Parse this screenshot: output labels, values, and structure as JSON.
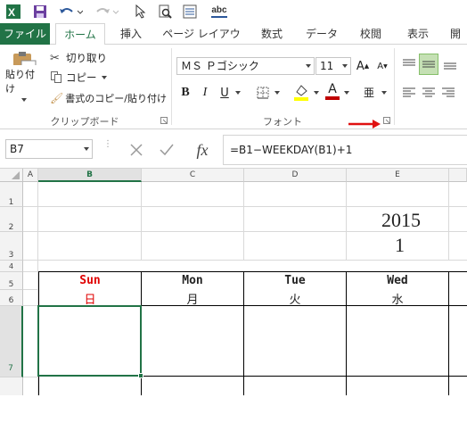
{
  "qat": {
    "app_icon": "excel-logo-icon",
    "save_icon": "save-icon",
    "undo_icon": "undo-icon",
    "redo_icon": "redo-icon",
    "pointer_icon": "pointer-icon",
    "preview_icon": "print-preview-icon",
    "form_icon": "form-icon",
    "spell_label": "abc"
  },
  "tabs": [
    "ファイル",
    "ホーム",
    "挿入",
    "ページ レイアウト",
    "数式",
    "データ",
    "校閲",
    "表示",
    "開"
  ],
  "clipboard": {
    "paste_label": "貼り付け",
    "cut_label": "切り取り",
    "copy_label": "コピー",
    "format_painter_label": "書式のコピー/貼り付け",
    "group_label": "クリップボード"
  },
  "font": {
    "font_name": "ＭＳ Ｐゴシック",
    "font_size": "11",
    "grow_label": "A",
    "shrink_label": "A",
    "bold_label": "B",
    "italic_label": "I",
    "underline_label": "U",
    "font_color_label": "A",
    "phonetic_label": "亜",
    "group_label": "フォント"
  },
  "colors": {
    "accent": "#217346",
    "arrow": "#e01010",
    "sunday": "#e00000"
  },
  "formula_bar": {
    "name_box": "B7",
    "fx_label": "fx",
    "formula": "=B1−WEEKDAY(B1)+1"
  },
  "columns": [
    "A",
    "B",
    "C",
    "D",
    "E"
  ],
  "rows": [
    "1",
    "2",
    "3",
    "4",
    "5",
    "6",
    "7"
  ],
  "cells": {
    "year": "2015",
    "month": "1"
  },
  "days": [
    {
      "en": "Sun",
      "jp": "日"
    },
    {
      "en": "Mon",
      "jp": "月"
    },
    {
      "en": "Tue",
      "jp": "火"
    },
    {
      "en": "Wed",
      "jp": "水"
    }
  ]
}
